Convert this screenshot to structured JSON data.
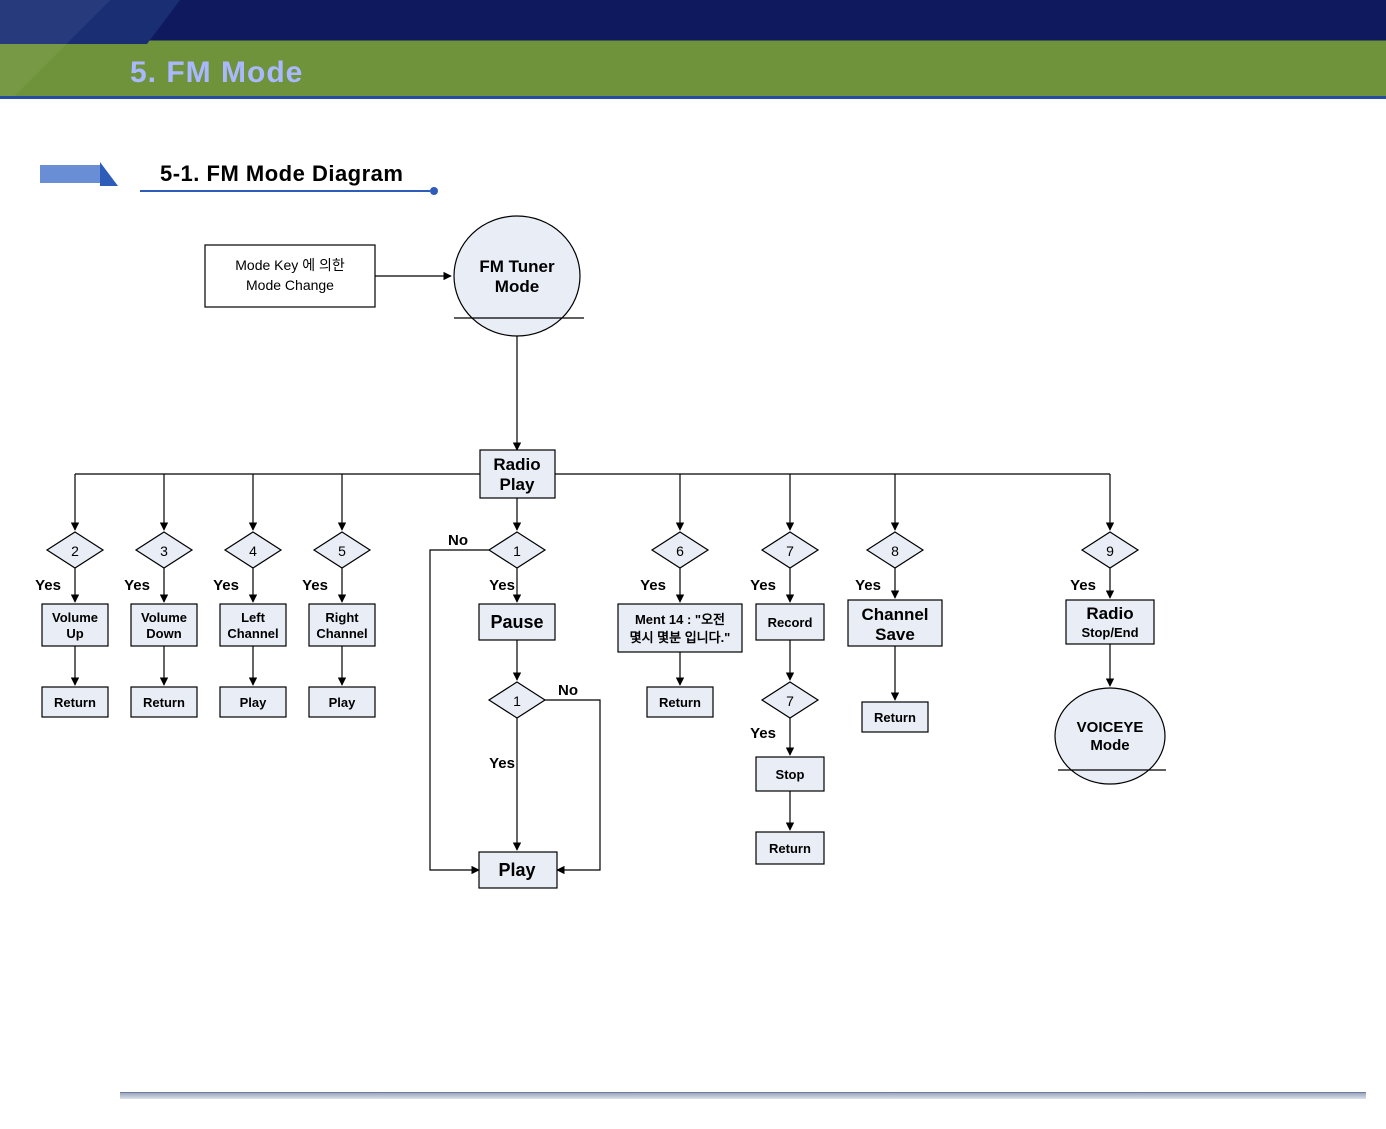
{
  "header": {
    "title": "5. FM Mode"
  },
  "subtitle": {
    "text": "5-1. FM Mode Diagram"
  },
  "nodes": {
    "mode_change": {
      "line1": "Mode Key 에 의한",
      "line2": "Mode Change"
    },
    "fm_tuner": {
      "line1": "FM Tuner",
      "line2": "Mode"
    },
    "radio_play": {
      "line1": "Radio",
      "line2": "Play"
    },
    "pause": "Pause",
    "play": "Play",
    "d1a": "1",
    "d1b": "1",
    "d2": "2",
    "d3": "3",
    "d4": "4",
    "d5": "5",
    "d6": "6",
    "d7a": "7",
    "d7b": "7",
    "d8": "8",
    "d9": "9",
    "vol_up": {
      "line1": "Volume",
      "line2": "Up"
    },
    "vol_down": {
      "line1": "Volume",
      "line2": "Down"
    },
    "left_ch": {
      "line1": "Left",
      "line2": "Channel"
    },
    "right_ch": {
      "line1": "Right",
      "line2": "Channel"
    },
    "return": "Return",
    "play_small": "Play",
    "ment14": {
      "line1": "Ment 14 : \"오전",
      "line2": "몇시 몇분 입니다.\""
    },
    "record": "Record",
    "stop": "Stop",
    "ch_save": {
      "line1": "Channel",
      "line2": "Save"
    },
    "radio_stop": {
      "line1": "Radio",
      "line2": "Stop/End"
    },
    "voiceye": {
      "line1": "VOICEYE",
      "line2": "Mode"
    }
  },
  "labels": {
    "yes": "Yes",
    "no": "No"
  },
  "chart_data": {
    "type": "flowchart",
    "title": "5-1. FM Mode Diagram",
    "nodes": [
      {
        "id": "mode_change",
        "shape": "rect",
        "label": "Mode Key 에 의한 Mode Change"
      },
      {
        "id": "fm_tuner",
        "shape": "circle",
        "label": "FM Tuner Mode"
      },
      {
        "id": "radio_play",
        "shape": "rect",
        "label": "Radio Play"
      },
      {
        "id": "d2",
        "shape": "diamond",
        "label": "2"
      },
      {
        "id": "d3",
        "shape": "diamond",
        "label": "3"
      },
      {
        "id": "d4",
        "shape": "diamond",
        "label": "4"
      },
      {
        "id": "d5",
        "shape": "diamond",
        "label": "5"
      },
      {
        "id": "d1a",
        "shape": "diamond",
        "label": "1"
      },
      {
        "id": "d6",
        "shape": "diamond",
        "label": "6"
      },
      {
        "id": "d7a",
        "shape": "diamond",
        "label": "7"
      },
      {
        "id": "d8",
        "shape": "diamond",
        "label": "8"
      },
      {
        "id": "d9",
        "shape": "diamond",
        "label": "9"
      },
      {
        "id": "vol_up",
        "shape": "rect",
        "label": "Volume Up"
      },
      {
        "id": "vol_down",
        "shape": "rect",
        "label": "Volume Down"
      },
      {
        "id": "left_ch",
        "shape": "rect",
        "label": "Left Channel"
      },
      {
        "id": "right_ch",
        "shape": "rect",
        "label": "Right Channel"
      },
      {
        "id": "ret2",
        "shape": "rect",
        "label": "Return"
      },
      {
        "id": "ret3",
        "shape": "rect",
        "label": "Return"
      },
      {
        "id": "play4",
        "shape": "rect",
        "label": "Play"
      },
      {
        "id": "play5",
        "shape": "rect",
        "label": "Play"
      },
      {
        "id": "pause",
        "shape": "rect",
        "label": "Pause"
      },
      {
        "id": "d1b",
        "shape": "diamond",
        "label": "1"
      },
      {
        "id": "play_main",
        "shape": "rect",
        "label": "Play"
      },
      {
        "id": "ment14",
        "shape": "rect",
        "label": "Ment 14 : \"오전 몇시 몇분 입니다.\""
      },
      {
        "id": "ret6",
        "shape": "rect",
        "label": "Return"
      },
      {
        "id": "record",
        "shape": "rect",
        "label": "Record"
      },
      {
        "id": "d7b",
        "shape": "diamond",
        "label": "7"
      },
      {
        "id": "stop",
        "shape": "rect",
        "label": "Stop"
      },
      {
        "id": "ret7",
        "shape": "rect",
        "label": "Return"
      },
      {
        "id": "ch_save",
        "shape": "rect",
        "label": "Channel Save"
      },
      {
        "id": "ret8",
        "shape": "rect",
        "label": "Return"
      },
      {
        "id": "radio_stop",
        "shape": "rect",
        "label": "Radio Stop/End"
      },
      {
        "id": "voiceye",
        "shape": "circle",
        "label": "VOICEYE Mode"
      }
    ],
    "edges": [
      {
        "from": "mode_change",
        "to": "fm_tuner"
      },
      {
        "from": "fm_tuner",
        "to": "radio_play"
      },
      {
        "from": "radio_play",
        "to": "d2"
      },
      {
        "from": "radio_play",
        "to": "d3"
      },
      {
        "from": "radio_play",
        "to": "d4"
      },
      {
        "from": "radio_play",
        "to": "d5"
      },
      {
        "from": "radio_play",
        "to": "d1a"
      },
      {
        "from": "radio_play",
        "to": "d6"
      },
      {
        "from": "radio_play",
        "to": "d7a"
      },
      {
        "from": "radio_play",
        "to": "d8"
      },
      {
        "from": "radio_play",
        "to": "d9"
      },
      {
        "from": "d2",
        "to": "vol_up",
        "label": "Yes"
      },
      {
        "from": "d3",
        "to": "vol_down",
        "label": "Yes"
      },
      {
        "from": "d4",
        "to": "left_ch",
        "label": "Yes"
      },
      {
        "from": "d5",
        "to": "right_ch",
        "label": "Yes"
      },
      {
        "from": "vol_up",
        "to": "ret2"
      },
      {
        "from": "vol_down",
        "to": "ret3"
      },
      {
        "from": "left_ch",
        "to": "play4"
      },
      {
        "from": "right_ch",
        "to": "play5"
      },
      {
        "from": "d1a",
        "to": "pause",
        "label": "Yes"
      },
      {
        "from": "d1a",
        "to": "play_main",
        "label": "No"
      },
      {
        "from": "pause",
        "to": "d1b"
      },
      {
        "from": "d1b",
        "to": "play_main",
        "label": "Yes"
      },
      {
        "from": "d1b",
        "to": "play_main",
        "label": "No"
      },
      {
        "from": "d6",
        "to": "ment14",
        "label": "Yes"
      },
      {
        "from": "ment14",
        "to": "ret6"
      },
      {
        "from": "d7a",
        "to": "record",
        "label": "Yes"
      },
      {
        "from": "record",
        "to": "d7b"
      },
      {
        "from": "d7b",
        "to": "stop",
        "label": "Yes"
      },
      {
        "from": "stop",
        "to": "ret7"
      },
      {
        "from": "d8",
        "to": "ch_save",
        "label": "Yes"
      },
      {
        "from": "ch_save",
        "to": "ret8"
      },
      {
        "from": "d9",
        "to": "radio_stop",
        "label": "Yes"
      },
      {
        "from": "radio_stop",
        "to": "voiceye"
      }
    ]
  }
}
